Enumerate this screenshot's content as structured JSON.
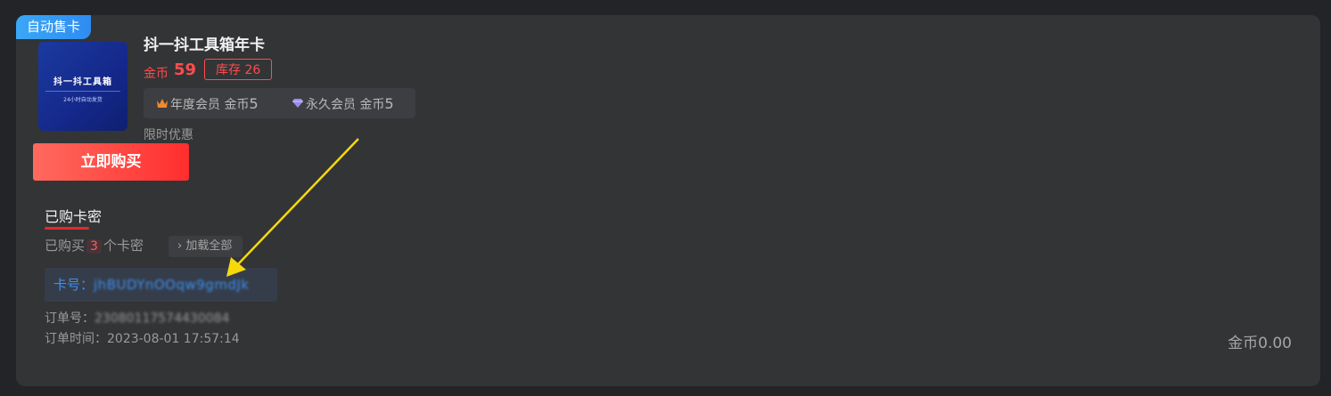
{
  "badge": "自动售卡",
  "product": {
    "title": "抖一抖工具箱年卡",
    "cover_title": "抖一抖工具箱",
    "cover_subtitle": "24小时自动发货",
    "price_label": "金币",
    "price_value": "59",
    "stock": "库存 26",
    "members": [
      {
        "icon": "crown-icon",
        "label": "年度会员 金币",
        "value": "5"
      },
      {
        "icon": "diamond-icon",
        "label": "永久会员 金币",
        "value": "5"
      }
    ],
    "limited_offer": "限时优惠",
    "buy_button": "立即购买"
  },
  "purchased": {
    "section_title": "已购卡密",
    "bought_prefix": "已购买",
    "bought_count": "3",
    "bought_suffix": "个卡密",
    "load_all": "加载全部",
    "card_label": "卡号：",
    "card_value": "jhBUDYnOOqw9gmdJk",
    "order_no_label": "订单号：",
    "order_no_value": "23080117574430084",
    "order_time_label": "订单时间：",
    "order_time_value": "2023-08-01 17:57:14"
  },
  "total": "金币0.00",
  "colors": {
    "accent_red": "#ff4c4c",
    "badge_blue": "#3aa7f6",
    "link_blue": "#3b8ff0",
    "annotation_arrow": "#f5d90a"
  }
}
